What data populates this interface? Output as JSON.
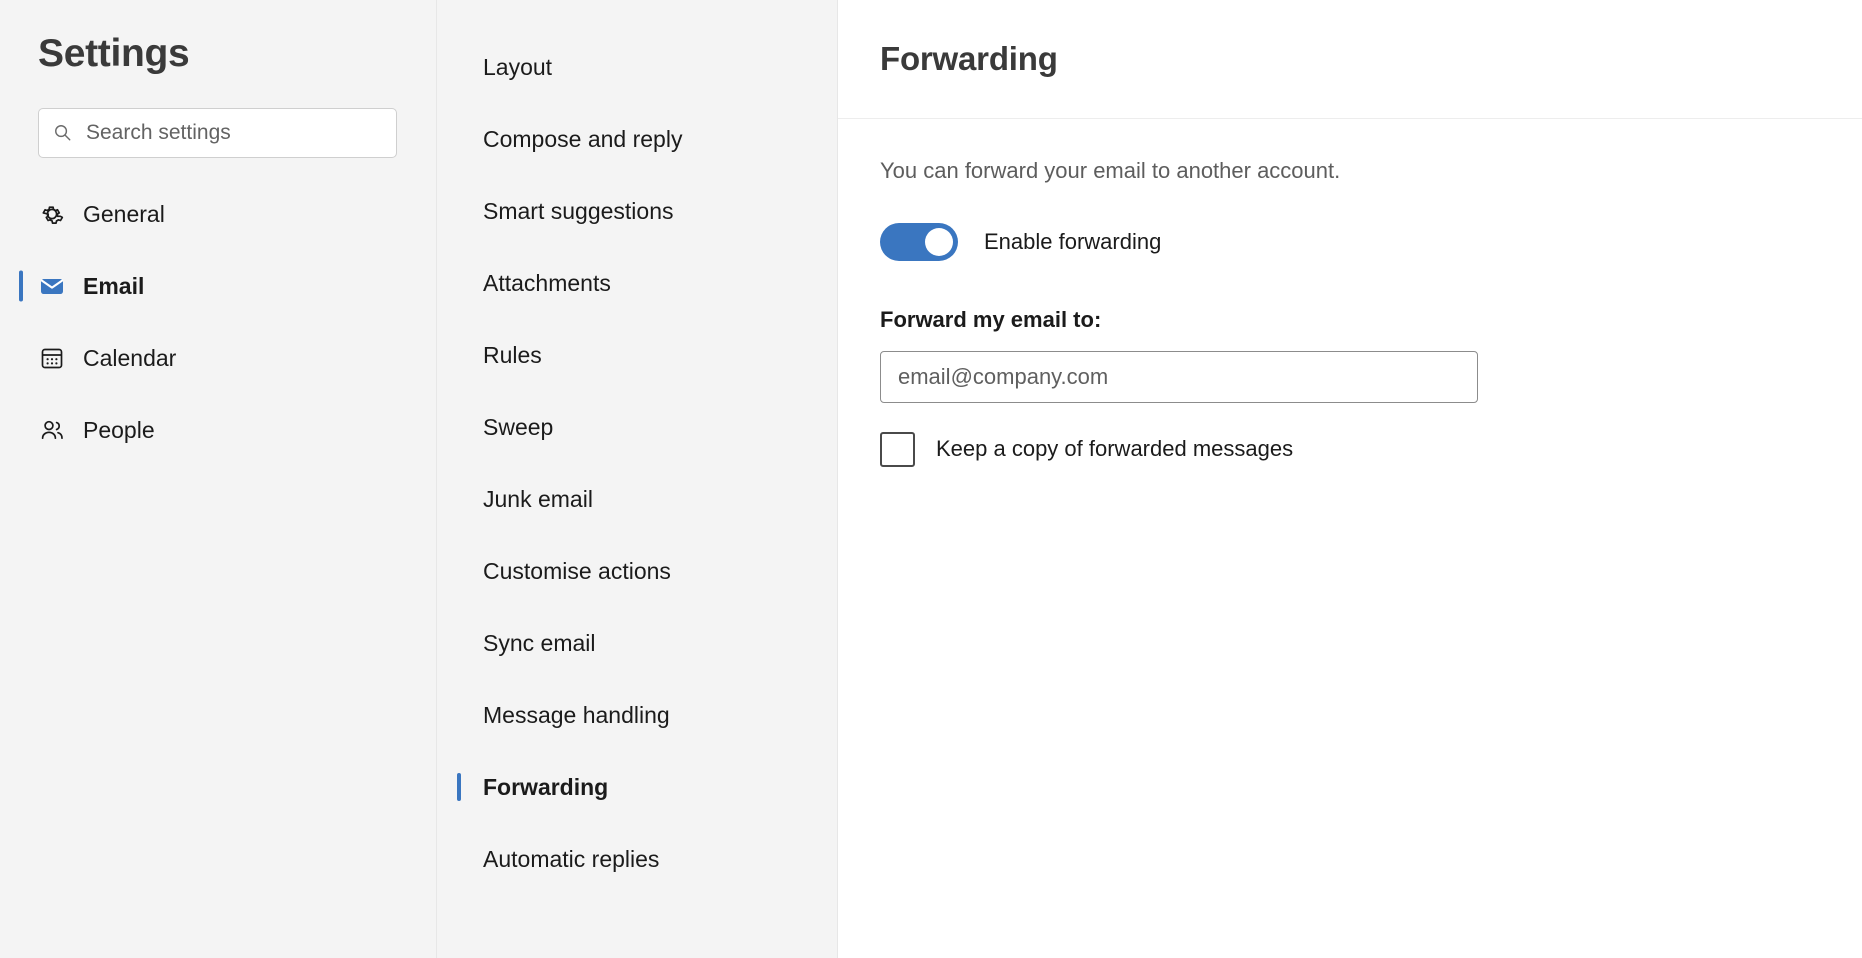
{
  "sidebar": {
    "title": "Settings",
    "search": {
      "placeholder": "Search settings",
      "value": "",
      "icon": "search-icon"
    },
    "items": [
      {
        "label": "General",
        "icon": "gear-icon",
        "selected": false
      },
      {
        "label": "Email",
        "icon": "envelope-icon",
        "selected": true
      },
      {
        "label": "Calendar",
        "icon": "calendar-icon",
        "selected": false
      },
      {
        "label": "People",
        "icon": "people-icon",
        "selected": false
      }
    ]
  },
  "subnav": {
    "items": [
      {
        "label": "Layout",
        "selected": false
      },
      {
        "label": "Compose and reply",
        "selected": false
      },
      {
        "label": "Smart suggestions",
        "selected": false
      },
      {
        "label": "Attachments",
        "selected": false
      },
      {
        "label": "Rules",
        "selected": false
      },
      {
        "label": "Sweep",
        "selected": false
      },
      {
        "label": "Junk email",
        "selected": false
      },
      {
        "label": "Customise actions",
        "selected": false
      },
      {
        "label": "Sync email",
        "selected": false
      },
      {
        "label": "Message handling",
        "selected": false
      },
      {
        "label": "Forwarding",
        "selected": true
      },
      {
        "label": "Automatic replies",
        "selected": false
      }
    ]
  },
  "main": {
    "title": "Forwarding",
    "description": "You can forward your email to another account.",
    "toggle": {
      "label": "Enable forwarding",
      "on": true
    },
    "forward_to": {
      "label": "Forward my email to:",
      "placeholder": "email@company.com",
      "value": ""
    },
    "keep_copy": {
      "label": "Keep a copy of forwarded messages",
      "checked": false
    }
  },
  "colors": {
    "accent": "#3a76c0",
    "panel_bg": "#f4f4f4",
    "content_bg": "#ffffff",
    "divider": "#e7e7e7",
    "text": "#1b1b1b",
    "muted_text": "#5d5d5d"
  }
}
